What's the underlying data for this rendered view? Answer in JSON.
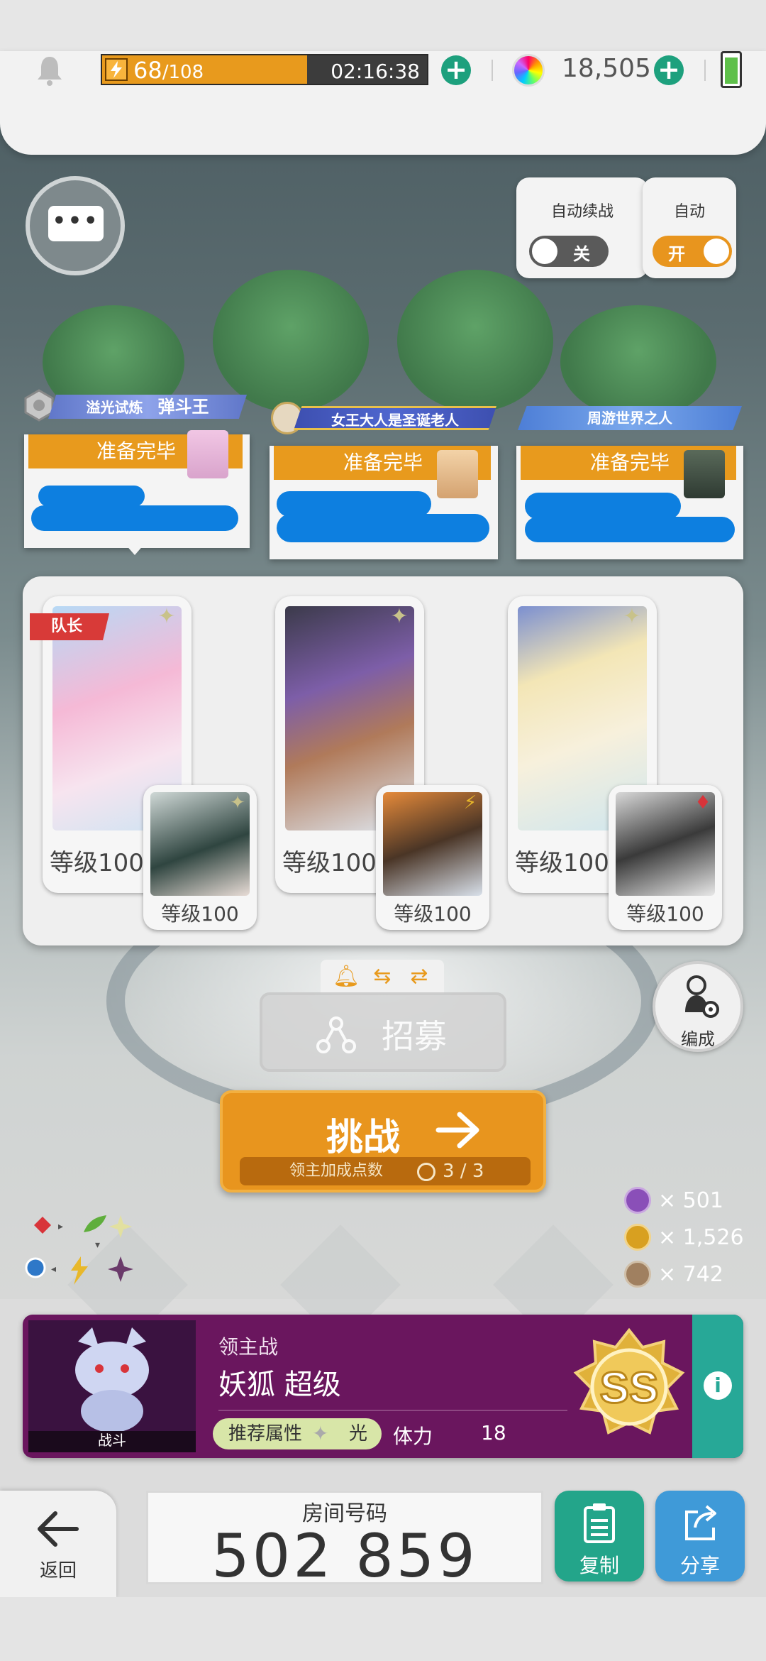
{
  "topbar": {
    "stamina_current": "68",
    "stamina_max": "/108",
    "stamina_fraction": 0.63,
    "stamina_timer": "02:16:38",
    "gem_count": "18,505",
    "icons": [
      "bell-icon",
      "bolt-icon",
      "plus-icon",
      "gem-icon",
      "battery-icon"
    ]
  },
  "toggles": {
    "auto_continue": {
      "title": "自动续战",
      "state_label": "关",
      "on": false
    },
    "auto": {
      "title": "自动",
      "state_label": "开",
      "on": true
    }
  },
  "players": [
    {
      "banner": "溢光试炼",
      "banner_extra": "弹斗王",
      "status": "准备完毕"
    },
    {
      "banner": "女王大人是圣诞老人",
      "status": "准备完毕"
    },
    {
      "banner": "周游世界之人",
      "status": "准备完毕"
    }
  ],
  "team": {
    "leader_tag": "队长",
    "slots": [
      {
        "main_level": "等级100",
        "sub_level": "等级100",
        "main_element": "✦",
        "sub_element": "✦"
      },
      {
        "main_level": "等级100",
        "sub_level": "等级100",
        "main_element": "✦",
        "sub_element": "⚡"
      },
      {
        "main_level": "等级100",
        "sub_level": "等级100",
        "main_element": "✦",
        "sub_element": "♦"
      }
    ]
  },
  "controls": {
    "recruit_label": "招募",
    "formation_label": "编成",
    "challenge_label": "挑战",
    "bonus_label": "领主加成点数",
    "bonus_value": "3 / 3"
  },
  "medals": [
    {
      "count": "× 501",
      "color": "#8a4fb8"
    },
    {
      "count": "× 1,526",
      "color": "#d8a020"
    },
    {
      "count": "× 742",
      "color": "#a08060"
    }
  ],
  "boss": {
    "fight_label": "战斗",
    "type": "领主战",
    "name": "妖狐 超级",
    "attr_label": "推荐属性",
    "attr_value": "光",
    "stamina_label": "体力",
    "stamina_value": "18",
    "rank": "SS"
  },
  "bottom": {
    "back_label": "返回",
    "room_label": "房间号码",
    "room_number": "502 859",
    "copy_label": "复制",
    "share_label": "分享"
  },
  "colors": {
    "accent_orange": "#e8951e",
    "teal": "#1da07d",
    "boss_purple": "#6a165e",
    "share_blue": "#3f9ad8",
    "copy_green": "#23a58a"
  }
}
